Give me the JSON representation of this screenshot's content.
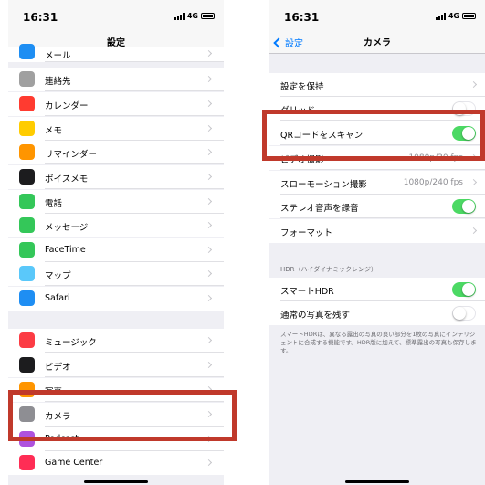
{
  "left": {
    "time": "16:31",
    "network": "4G",
    "title": "設定",
    "items": [
      {
        "label": "メール",
        "icon": "mail-icon",
        "color": "#1e8ef3"
      },
      {
        "label": "連絡先",
        "icon": "contacts-icon",
        "color": "#a0a0a0"
      },
      {
        "label": "カレンダー",
        "icon": "calendar-icon",
        "color": "#ff3b30"
      },
      {
        "label": "メモ",
        "icon": "notes-icon",
        "color": "#ffcc00"
      },
      {
        "label": "リマインダー",
        "icon": "reminders-icon",
        "color": "#ff9500"
      },
      {
        "label": "ボイスメモ",
        "icon": "voice-memo-icon",
        "color": "#1c1c1e"
      },
      {
        "label": "電話",
        "icon": "phone-icon",
        "color": "#34c759"
      },
      {
        "label": "メッセージ",
        "icon": "messages-icon",
        "color": "#34c759"
      },
      {
        "label": "FaceTime",
        "icon": "facetime-icon",
        "color": "#34c759"
      },
      {
        "label": "マップ",
        "icon": "maps-icon",
        "color": "#5ac8fa"
      },
      {
        "label": "Safari",
        "icon": "safari-icon",
        "color": "#1e8ef3"
      },
      {
        "label": "ミュージック",
        "icon": "music-icon",
        "color": "#fc3c44"
      },
      {
        "label": "ビデオ",
        "icon": "video-icon",
        "color": "#1c1c1e"
      },
      {
        "label": "写真",
        "icon": "photos-icon",
        "color": "#ff9500"
      },
      {
        "label": "カメラ",
        "icon": "camera-icon",
        "color": "#8e8e93"
      },
      {
        "label": "Podcast",
        "icon": "podcast-icon",
        "color": "#af52de"
      },
      {
        "label": "Game Center",
        "icon": "game-center-icon",
        "color": "#ff2d55"
      }
    ]
  },
  "right": {
    "time": "16:31",
    "network": "4G",
    "back_label": "設定",
    "title": "カメラ",
    "rows": [
      {
        "label": "設定を保持",
        "type": "chevron"
      },
      {
        "label": "グリッド",
        "type": "toggle",
        "on": false
      },
      {
        "label": "QRコードをスキャン",
        "type": "toggle",
        "on": true
      },
      {
        "label": "ビデオ撮影",
        "type": "value",
        "value": "1080p/30 fps"
      },
      {
        "label": "スローモーション撮影",
        "type": "value",
        "value": "1080p/240 fps"
      },
      {
        "label": "ステレオ音声を録音",
        "type": "toggle",
        "on": true
      },
      {
        "label": "フォーマット",
        "type": "chevron"
      }
    ],
    "hdr_header": "HDR（ハイダイナミックレンジ）",
    "hdr_rows": [
      {
        "label": "スマートHDR",
        "on": true
      },
      {
        "label": "通常の写真を残す",
        "on": false
      }
    ],
    "hdr_footnote": "スマートHDRは、異なる露出の写真の良い部分を1枚の写真にインテリジェントに合成する機能です。HDR版に加えて、標準露出の写真も保存します。"
  }
}
